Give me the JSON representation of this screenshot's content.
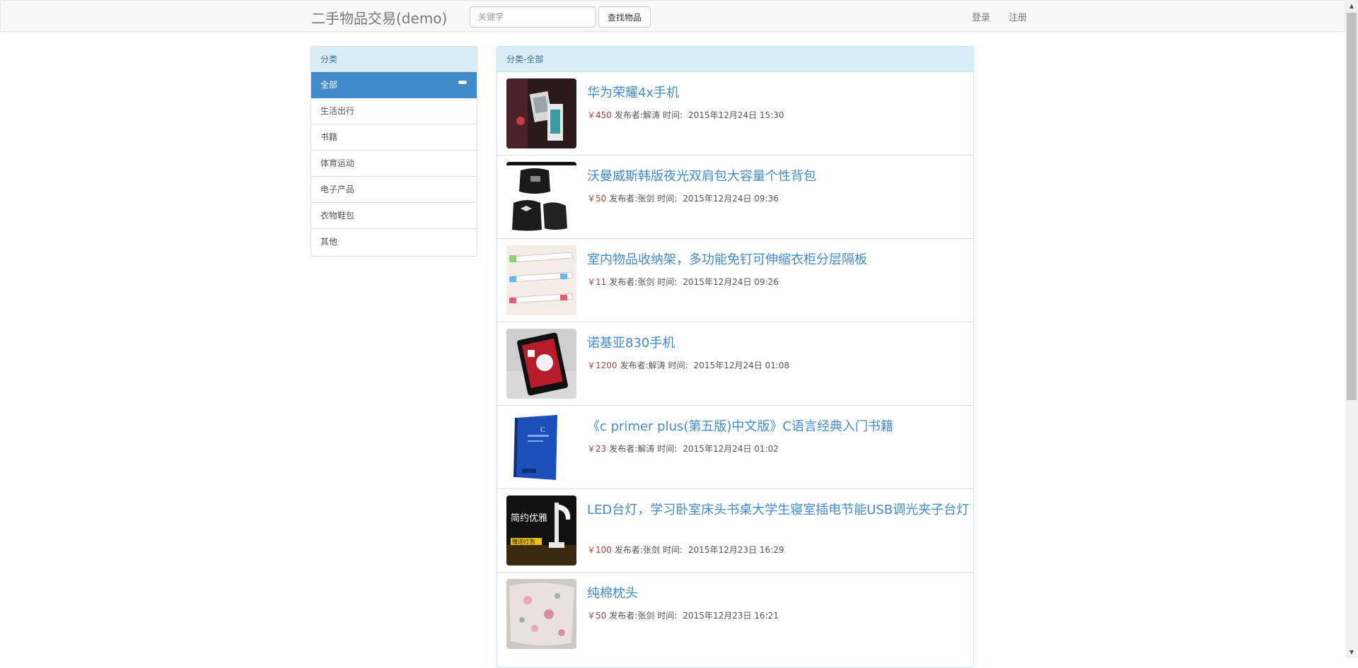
{
  "navbar": {
    "brand": "二手物品交易(demo)",
    "search_placeholder": "关键字",
    "search_button": "查找物品",
    "login": "登录",
    "register": "注册"
  },
  "sidebar": {
    "heading": "分类",
    "items": [
      {
        "label": "全部",
        "active": true
      },
      {
        "label": "生活出行"
      },
      {
        "label": "书籍"
      },
      {
        "label": "体育运动"
      },
      {
        "label": "电子产品"
      },
      {
        "label": "衣物鞋包"
      },
      {
        "label": "其他"
      }
    ]
  },
  "main": {
    "heading": "分类-全部",
    "currency": "￥",
    "publisher_label": "发布者:",
    "time_label": "时间:",
    "items": [
      {
        "title": "华为荣耀4x手机",
        "price": "450",
        "publisher": "解涛",
        "time": "2015年12月24日 15:30",
        "image_icon": "phone-photo-icon"
      },
      {
        "title": "沃曼威斯韩版夜光双肩包大容量个性背包",
        "price": "50",
        "publisher": "张剑",
        "time": "2015年12月24日 09:36",
        "image_icon": "backpack-photo-icon"
      },
      {
        "title": "室内物品收纳架，多功能免钉可伸缩衣柜分层隔板",
        "price": "11",
        "publisher": "张剑",
        "time": "2015年12月24日 09:26",
        "image_icon": "shelf-photo-icon"
      },
      {
        "title": "诺基亚830手机",
        "price": "1200",
        "publisher": "解涛",
        "time": "2015年12月24日 01:08",
        "image_icon": "phone-photo-icon"
      },
      {
        "title": "《c primer plus(第五版)中文版》C语言经典入门书籍",
        "price": "23",
        "publisher": "解涛",
        "time": "2015年12月24日 01:02",
        "image_icon": "book-photo-icon"
      },
      {
        "title": "LED台灯，学习卧室床头书桌大学生寝室插电节能USB调光夹子台灯",
        "price": "100",
        "publisher": "张剑",
        "time": "2015年12月23日 16:29",
        "image_icon": "lamp-photo-icon",
        "image_text": [
          "简约优雅",
          "赠送灯泡"
        ]
      },
      {
        "title": "纯棉枕头",
        "price": "50",
        "publisher": "张剑",
        "time": "2015年12月23日 16:21",
        "image_icon": "pillow-photo-icon"
      }
    ]
  },
  "colors": {
    "link": "#428bca",
    "active": "#428bca",
    "panel_heading_bg": "#d9edf7",
    "panel_heading_text": "#31708f",
    "price": "#a94442"
  }
}
